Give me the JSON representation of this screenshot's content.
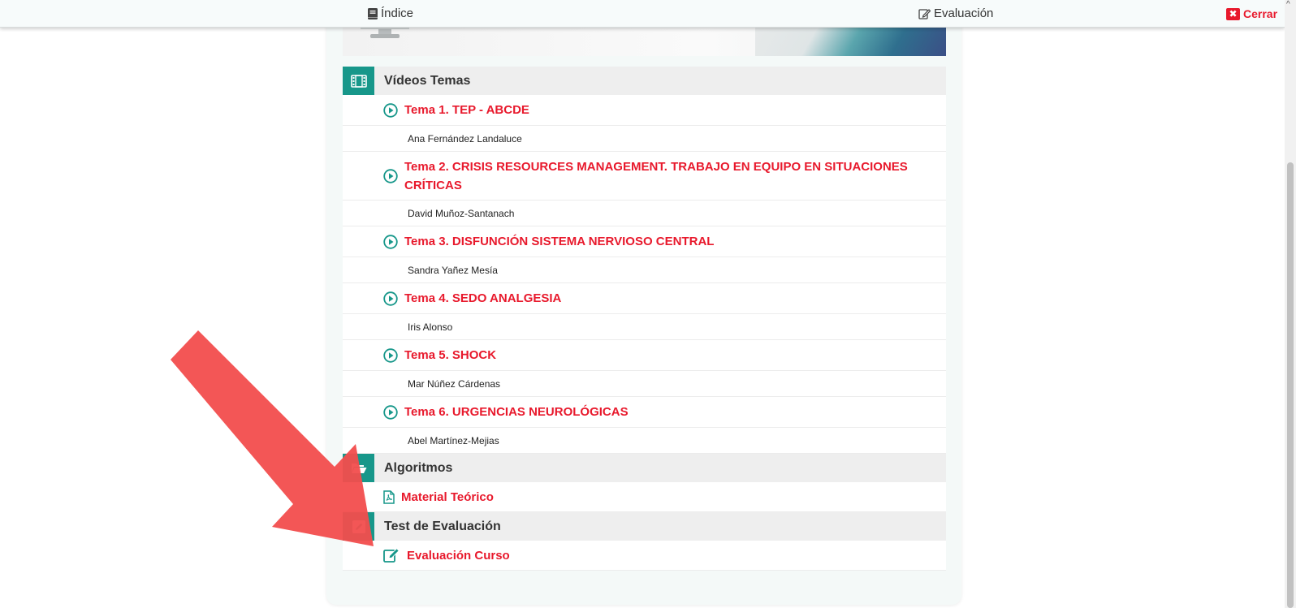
{
  "topbar": {
    "index_label": "Índice",
    "evaluation_label": "Evaluación",
    "close_label": "Cerrar",
    "close_symbol": "✖"
  },
  "sections": {
    "videos": {
      "title": "Vídeos Temas",
      "topics": [
        {
          "title": "Tema 1. TEP - ABCDE",
          "author": "Ana Fernández Landaluce"
        },
        {
          "title": "Tema 2. CRISIS RESOURCES MANAGEMENT. TRABAJO EN EQUIPO EN SITUACIONES CRÍTICAS",
          "author": "David Muñoz-Santanach"
        },
        {
          "title": "Tema 3. DISFUNCIÓN SISTEMA NERVIOSO CENTRAL",
          "author": "Sandra Yañez Mesía"
        },
        {
          "title": "Tema 4. SEDO ANALGESIA",
          "author": "Iris Alonso"
        },
        {
          "title": "Tema 5. SHOCK",
          "author": "Mar Núñez Cárdenas"
        },
        {
          "title": "Tema 6. URGENCIAS NEUROLÓGICAS",
          "author": "Abel Martínez-Mejias"
        }
      ]
    },
    "algorithms": {
      "title": "Algoritmos",
      "link": "Material Teórico"
    },
    "test": {
      "title": "Test de Evaluación",
      "link": "Evaluación Curso"
    }
  },
  "colors": {
    "accent_teal": "#17978a",
    "link_red": "#e8192c",
    "arrow_red": "#f24d4d"
  }
}
